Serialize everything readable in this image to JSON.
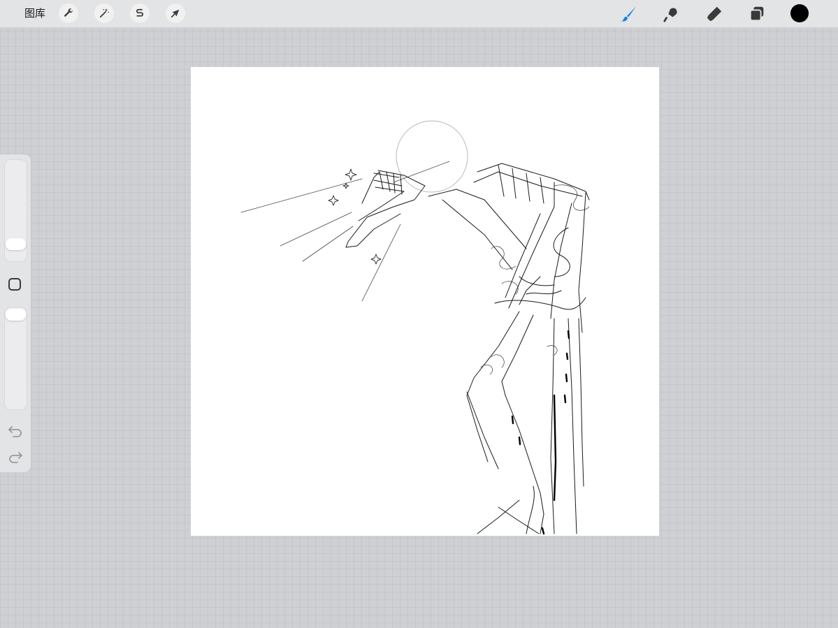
{
  "topbar": {
    "gallery_label": "图库",
    "left_tools": [
      {
        "icon": "wrench-icon",
        "name": "actions"
      },
      {
        "icon": "magic-wand-icon",
        "name": "adjustments"
      },
      {
        "icon": "selection-s-icon",
        "name": "selection"
      },
      {
        "icon": "arrow-cursor-icon",
        "name": "transform"
      }
    ],
    "right_tools": [
      {
        "icon": "brush-icon",
        "name": "paint",
        "active": true
      },
      {
        "icon": "smudge-icon",
        "name": "smudge"
      },
      {
        "icon": "eraser-icon",
        "name": "erase"
      },
      {
        "icon": "layers-icon",
        "name": "layers"
      }
    ],
    "accent_color": "#1a7fe8",
    "current_color": "#000000"
  },
  "sidebar": {
    "brush_size_level": 0.68,
    "opacity_level": 0.95,
    "modify_button_icon": "square-outline-icon",
    "undo_icon": "undo-arrow-icon",
    "redo_icon": "redo-arrow-icon"
  },
  "canvas": {
    "background": "#ffffff",
    "content": "pencil sketch"
  }
}
